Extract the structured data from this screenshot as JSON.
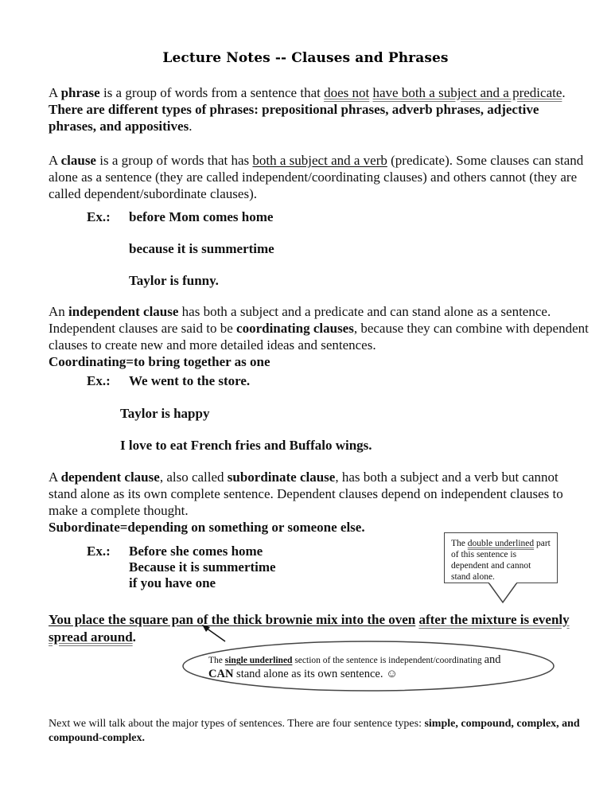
{
  "title": "Lecture Notes --  Clauses and Phrases",
  "phrase_para": {
    "t1": "A ",
    "b1": "phrase",
    "t2": " is a group of words from a sentence that ",
    "u_double": "does not",
    "t3": " ",
    "u_single": "have both a subject and a predicate",
    "t4": ".  ",
    "b2": "There are different types of phrases:  prepositional phrases, adverb phrases, adjective phrases, and appositives",
    "t5": "."
  },
  "clause_para": {
    "t1": "A ",
    "b1": "clause",
    "t2": " is a group of words that has ",
    "u1": "both a subject and a verb",
    "t3": " (predicate).  Some clauses can stand alone as a sentence (they are called independent/coordinating clauses) and others cannot (they are called dependent/subordinate clauses)."
  },
  "examples1": {
    "label": "Ex.:",
    "items": [
      "before Mom comes home",
      "because it is summertime",
      "Taylor is funny."
    ]
  },
  "independent_para": {
    "t1": "An ",
    "b1": "independent clause",
    "t2": " has both a subject and a predicate and can stand alone as a sentence.  Independent clauses are said to be ",
    "b2": "coordinating clauses",
    "t3": ", because they can combine with dependent clauses to create new and more detailed ideas and sentences.",
    "definition": "Coordinating=to bring together as one"
  },
  "examples2": {
    "label": "Ex.:",
    "items": [
      "We went to the store.",
      "Taylor is happy",
      "I love to eat French fries and Buffalo wings."
    ]
  },
  "dependent_para": {
    "t1": "A ",
    "b1": "dependent clause",
    "t2": ", also called ",
    "b2": "subordinate clause",
    "t3": ", has both a subject and a verb but cannot stand alone as its own complete sentence.  Dependent clauses depend on independent clauses to make a complete thought.",
    "definition": "Subordinate=depending on something or someone else."
  },
  "examples3": {
    "label": "Ex.:",
    "items": [
      "Before she comes home",
      "Because it is summertime",
      "if you have one"
    ]
  },
  "callout_box": {
    "t1": "The ",
    "u2": "double underlined",
    "t2": " part of this sentence is dependent and cannot stand alone."
  },
  "example_sentence": {
    "independent": "You place the square pan of the thick brownie mix into the oven",
    "space": " ",
    "dependent": "after the mixture is evenly spread around",
    "end": "."
  },
  "ellipse_callout": {
    "t1": "The ",
    "u1": "single underlined",
    "t2": " section of the sentence is independent/coordinating ",
    "t3": "and",
    "b1": "CAN",
    "t4": " stand alone as its own sentence.  ",
    "smiley": "☺"
  },
  "closing_para": {
    "t1": "Next we will talk about the major types of sentences.  There are four sentence types:   ",
    "b1": "simple, compound, complex, and compound-complex."
  }
}
